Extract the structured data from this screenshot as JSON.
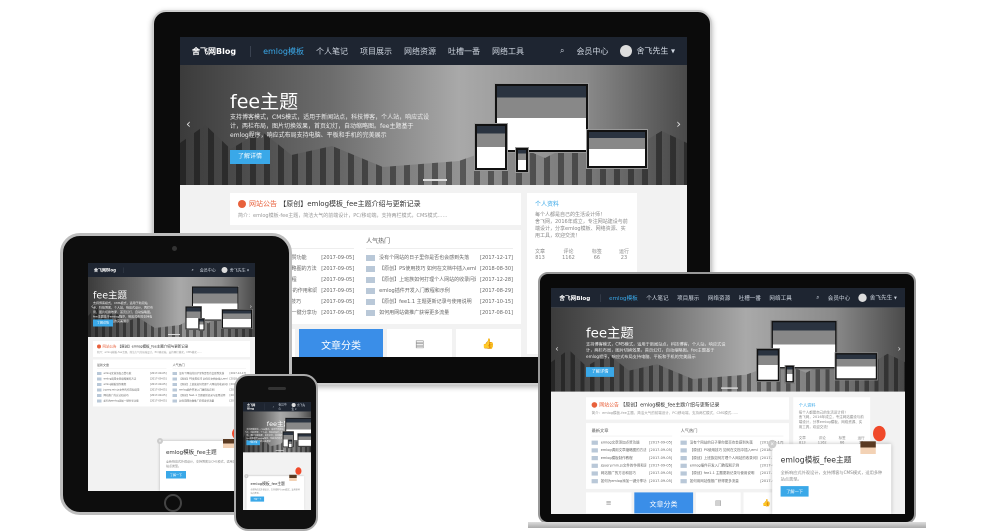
{
  "site": {
    "brand": "舍飞网Blog",
    "nav": [
      "emlog模板",
      "个人笔记",
      "项目展示",
      "网络资源",
      "吐槽一番",
      "网络工具"
    ],
    "member": "会员中心",
    "user": "舍飞先生 ▾",
    "hero": {
      "title": "fee主题",
      "desc": "支持博客模式，CMS模式，适用于新闻站点，科技博客，个人站，响应式设计，两栏布局，图片切换效果，首页幻灯，自动缩略图。fee主题基于emlog程序，响应式布局支持电脑、平板和手机的完美展示",
      "button": "了解详情"
    },
    "notice": {
      "tag": "网站公告",
      "title": "【原创】emlog模板_fee主题介绍与更新记录",
      "sub": "简介：emlog模板-fee主题，简洁大气的前端设计，PC/移动端，支持两栏模式，CMS模式……"
    },
    "latest": {
      "heading": "最新文章",
      "rows": [
        {
          "title": "emlog文章添加点赞功能",
          "date": "[2017-09-05]"
        },
        {
          "title": "emlog调用文章缩略图的方法",
          "date": "[2017-09-05]"
        },
        {
          "title": "emlog模板制作教程",
          "date": "[2017-09-05]"
        },
        {
          "title": "jquery.min.js文件的作用和调用",
          "date": "[2017-09-05]"
        },
        {
          "title": "网站推广的方法和技巧",
          "date": "[2017-09-05]"
        },
        {
          "title": "如何为emlog添加一键分享功能",
          "date": "[2017-09-05]"
        }
      ]
    },
    "hot": {
      "heading": "人气热门",
      "rows": [
        {
          "title": "没有个网站的日子里你是否也会感到失落",
          "date": "[2017-12-17]"
        },
        {
          "title": "【原创】PS使用技巧 如何在文档中插入emlog模板",
          "date": "[2018-08-30]"
        },
        {
          "title": "【原创】上班族如何打理个人网站的收录问题",
          "date": "[2017-12-28]"
        },
        {
          "title": "emlog插件开发入门教程和示例",
          "date": "[2017-08-29]"
        },
        {
          "title": "【原创】fee1.1 主题更新记录与使用说明",
          "date": "[2017-10-15]"
        },
        {
          "title": "如何用网站做推广获得更多流量",
          "date": "[2017-08-01]"
        }
      ]
    },
    "tiles": [
      "≡",
      "文章分类",
      "▤",
      "👍"
    ],
    "profile": {
      "heading": "个人资料",
      "line": "每个人都是自己的生活设计师！",
      "text": "舍飞网，2016年成立，专注网站建设与前端设计，分享emlog模板、网络资源、实用工具，欢迎交流！",
      "stats": [
        {
          "label": "文章",
          "value": "813"
        },
        {
          "label": "评论",
          "value": "1162"
        },
        {
          "label": "标签",
          "value": "66"
        },
        {
          "label": "运行",
          "value": "23"
        }
      ]
    },
    "popup": {
      "title": "emlog模板_fee主题",
      "desc": "全新响应式外观设计，支持博客与CMS模式，适用多种站点类型。",
      "button": "了解一下",
      "close": "×"
    }
  },
  "colors": {
    "accent": "#3aa8e8",
    "nav": "#1e2531",
    "notice": "#e8613c",
    "balloon": "#f0492a"
  }
}
